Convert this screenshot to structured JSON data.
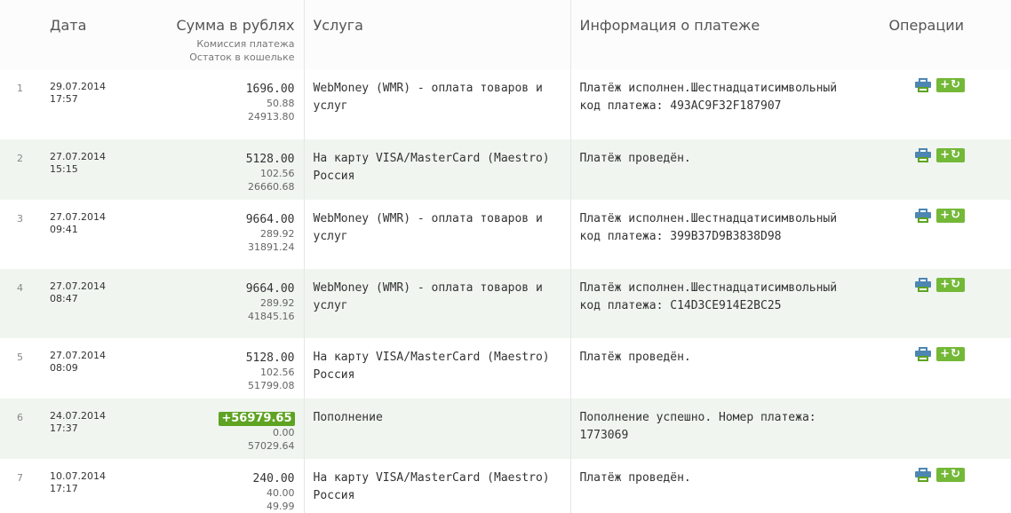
{
  "header": {
    "date": "Дата",
    "sum": "Сумма в рублях",
    "commission": "Комиссия платежа",
    "balance": "Остаток в кошельке",
    "service": "Услуга",
    "info": "Информация о платеже",
    "operations": "Операции"
  },
  "icons": {
    "print": "printer-icon",
    "repeat": "plus-repeat-icon"
  },
  "colors": {
    "accent": "#5ea322",
    "row_alt": "#f0f5f0",
    "print_icon": "#4d86b3"
  },
  "rows": [
    {
      "num": "1",
      "date": "29.07.2014",
      "time": "17:57",
      "amount": "1696.00",
      "commission": "50.88",
      "balance": "24913.80",
      "service": "WebMoney (WMR) - оплата товаров и услуг",
      "info": "Платёж исполнен.Шестнадцатисимвольный код платежа: 493AC9F32F187907",
      "income": false,
      "ops": true
    },
    {
      "num": "2",
      "date": "27.07.2014",
      "time": "15:15",
      "amount": "5128.00",
      "commission": "102.56",
      "balance": "26660.68",
      "service": "На карту VISA/MasterCard (Maestro) Россия",
      "info": "Платёж проведён.",
      "income": false,
      "ops": true
    },
    {
      "num": "3",
      "date": "27.07.2014",
      "time": "09:41",
      "amount": "9664.00",
      "commission": "289.92",
      "balance": "31891.24",
      "service": "WebMoney (WMR) - оплата товаров и услуг",
      "info": "Платёж исполнен.Шестнадцатисимвольный код платежа: 399B37D9B3838D98",
      "income": false,
      "ops": true
    },
    {
      "num": "4",
      "date": "27.07.2014",
      "time": "08:47",
      "amount": "9664.00",
      "commission": "289.92",
      "balance": "41845.16",
      "service": "WebMoney (WMR) - оплата товаров и услуг",
      "info": "Платёж исполнен.Шестнадцатисимвольный код платежа: C14D3CE914E2BC25",
      "income": false,
      "ops": true
    },
    {
      "num": "5",
      "date": "27.07.2014",
      "time": "08:09",
      "amount": "5128.00",
      "commission": "102.56",
      "balance": "51799.08",
      "service": "На карту VISA/MasterCard (Maestro) Россия",
      "info": "Платёж проведён.",
      "income": false,
      "ops": true
    },
    {
      "num": "6",
      "date": "24.07.2014",
      "time": "17:37",
      "amount": "+56979.65",
      "commission": "0.00",
      "balance": "57029.64",
      "service": "Пополнение",
      "info": "Пополнение успешно. Номер платежа: 1773069",
      "income": true,
      "ops": false
    },
    {
      "num": "7",
      "date": "10.07.2014",
      "time": "17:17",
      "amount": "240.00",
      "commission": "40.00",
      "balance": "49.99",
      "service": "На карту VISA/MasterCard (Maestro) Россия",
      "info": "Платёж проведён.",
      "income": false,
      "ops": true
    }
  ]
}
